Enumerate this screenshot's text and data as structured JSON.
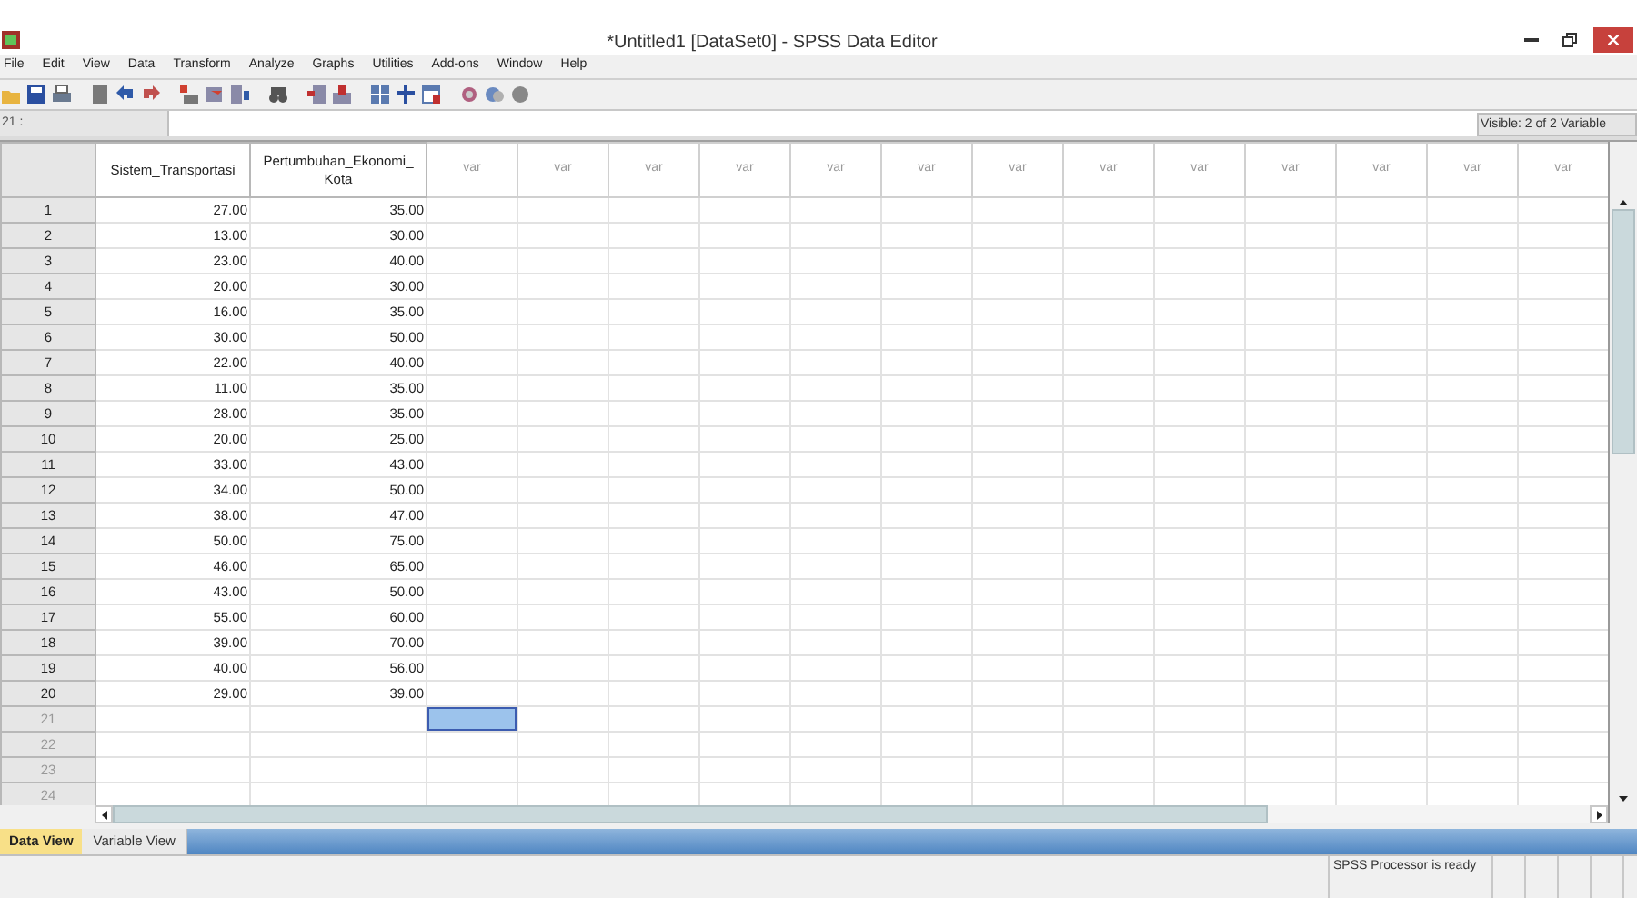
{
  "window": {
    "title": "*Untitled1 [DataSet0] - SPSS Data Editor"
  },
  "menu": [
    "File",
    "Edit",
    "View",
    "Data",
    "Transform",
    "Analyze",
    "Graphs",
    "Utilities",
    "Add-ons",
    "Window",
    "Help"
  ],
  "cell_editor": {
    "address": "21 :",
    "visible": "Visible: 2 of 2 Variable"
  },
  "table": {
    "columns": [
      {
        "label": "Sistem_Transportasi",
        "kind": "var"
      },
      {
        "label": "Pertumbuhan_Ekonomi_ Kota",
        "kind": "var"
      },
      {
        "label": "var",
        "kind": "empty"
      },
      {
        "label": "var",
        "kind": "empty"
      },
      {
        "label": "var",
        "kind": "empty"
      },
      {
        "label": "var",
        "kind": "empty"
      },
      {
        "label": "var",
        "kind": "empty"
      },
      {
        "label": "var",
        "kind": "empty"
      },
      {
        "label": "var",
        "kind": "empty"
      },
      {
        "label": "var",
        "kind": "empty"
      },
      {
        "label": "var",
        "kind": "empty"
      },
      {
        "label": "var",
        "kind": "empty"
      },
      {
        "label": "var",
        "kind": "empty"
      },
      {
        "label": "var",
        "kind": "empty"
      },
      {
        "label": "var",
        "kind": "empty"
      }
    ],
    "rows": [
      {
        "number": "1",
        "cells": [
          "27.00",
          "35.00"
        ],
        "filled": true,
        "selected": false
      },
      {
        "number": "2",
        "cells": [
          "13.00",
          "30.00"
        ],
        "filled": true,
        "selected": false
      },
      {
        "number": "3",
        "cells": [
          "23.00",
          "40.00"
        ],
        "filled": true,
        "selected": false
      },
      {
        "number": "4",
        "cells": [
          "20.00",
          "30.00"
        ],
        "filled": true,
        "selected": false
      },
      {
        "number": "5",
        "cells": [
          "16.00",
          "35.00"
        ],
        "filled": true,
        "selected": false
      },
      {
        "number": "6",
        "cells": [
          "30.00",
          "50.00"
        ],
        "filled": true,
        "selected": false
      },
      {
        "number": "7",
        "cells": [
          "22.00",
          "40.00"
        ],
        "filled": true,
        "selected": false
      },
      {
        "number": "8",
        "cells": [
          "11.00",
          "35.00"
        ],
        "filled": true,
        "selected": false
      },
      {
        "number": "9",
        "cells": [
          "28.00",
          "35.00"
        ],
        "filled": true,
        "selected": false
      },
      {
        "number": "10",
        "cells": [
          "20.00",
          "25.00"
        ],
        "filled": true,
        "selected": false
      },
      {
        "number": "11",
        "cells": [
          "33.00",
          "43.00"
        ],
        "filled": true,
        "selected": false
      },
      {
        "number": "12",
        "cells": [
          "34.00",
          "50.00"
        ],
        "filled": true,
        "selected": false
      },
      {
        "number": "13",
        "cells": [
          "38.00",
          "47.00"
        ],
        "filled": true,
        "selected": false
      },
      {
        "number": "14",
        "cells": [
          "50.00",
          "75.00"
        ],
        "filled": true,
        "selected": false
      },
      {
        "number": "15",
        "cells": [
          "46.00",
          "65.00"
        ],
        "filled": true,
        "selected": false
      },
      {
        "number": "16",
        "cells": [
          "43.00",
          "50.00"
        ],
        "filled": true,
        "selected": false
      },
      {
        "number": "17",
        "cells": [
          "55.00",
          "60.00"
        ],
        "filled": true,
        "selected": false
      },
      {
        "number": "18",
        "cells": [
          "39.00",
          "70.00"
        ],
        "filled": true,
        "selected": false
      },
      {
        "number": "19",
        "cells": [
          "40.00",
          "56.00"
        ],
        "filled": true,
        "selected": false
      },
      {
        "number": "20",
        "cells": [
          "29.00",
          "39.00"
        ],
        "filled": true,
        "selected": false
      },
      {
        "number": "21",
        "cells": [],
        "filled": false,
        "selected": true
      },
      {
        "number": "22",
        "cells": [],
        "filled": false,
        "selected": false
      },
      {
        "number": "23",
        "cells": [],
        "filled": false,
        "selected": false
      },
      {
        "number": "24",
        "cells": [],
        "filled": false,
        "selected": false
      }
    ]
  },
  "tabs": [
    {
      "label": "Data View",
      "selected": true
    },
    {
      "label": "Variable View",
      "selected": false
    }
  ],
  "status_bar": {
    "message": "SPSS  Processor is ready"
  }
}
